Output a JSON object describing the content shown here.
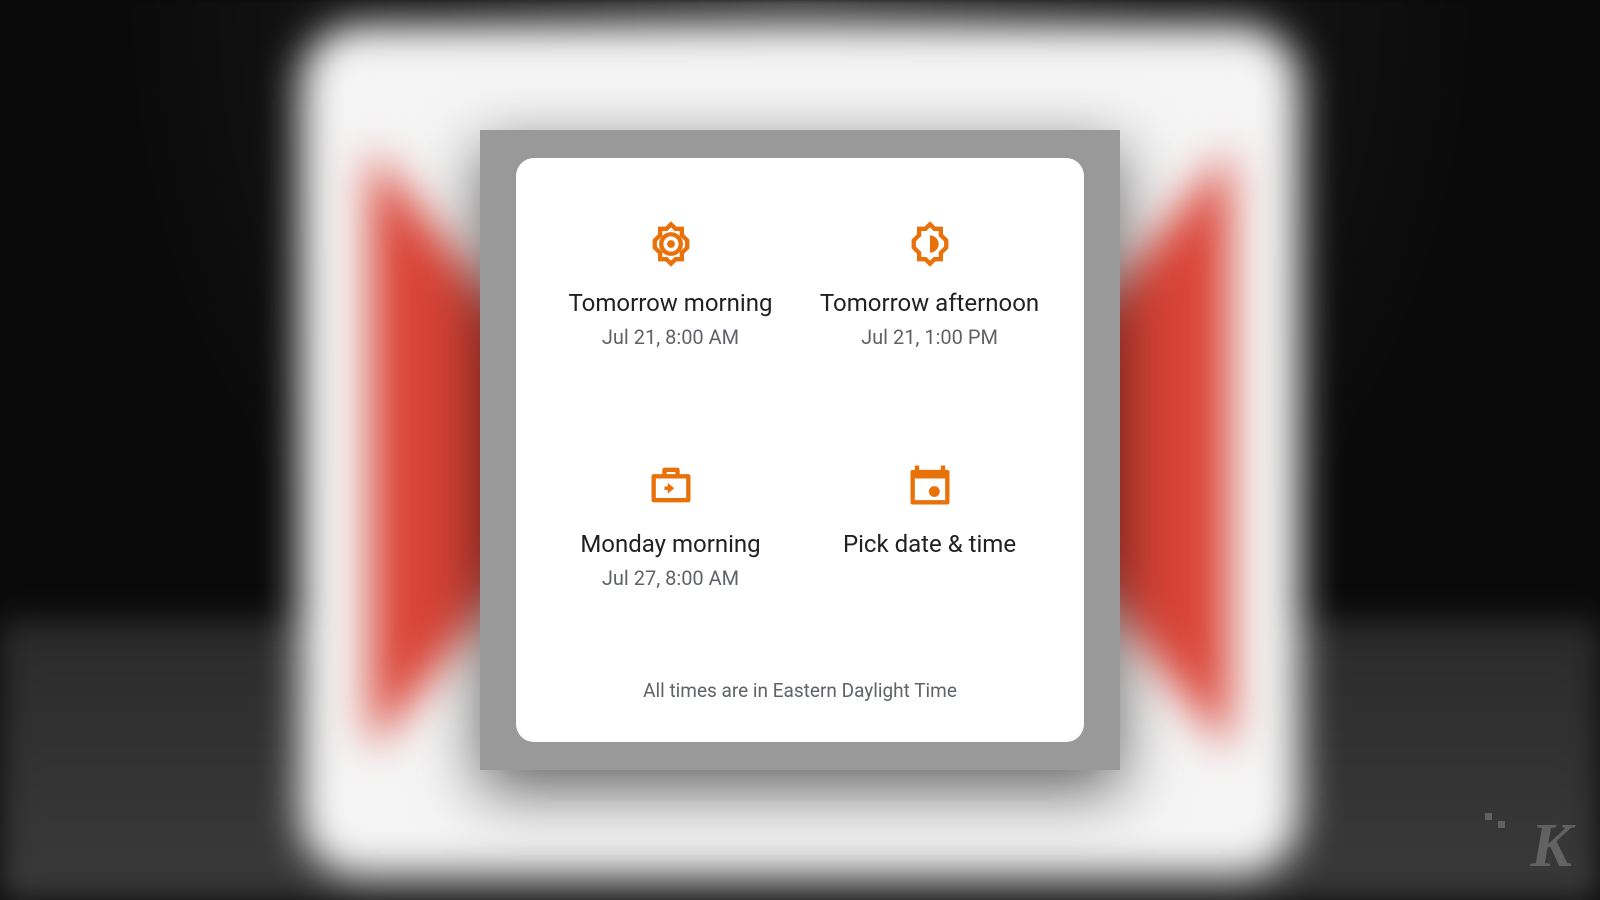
{
  "colors": {
    "accent": "#e8710a"
  },
  "dialog": {
    "options": [
      {
        "id": "tomorrow-morning",
        "title": "Tomorrow morning",
        "subtitle": "Jul 21, 8:00 AM",
        "icon": "brightness-full-icon"
      },
      {
        "id": "tomorrow-afternoon",
        "title": "Tomorrow afternoon",
        "subtitle": "Jul 21, 1:00 PM",
        "icon": "brightness-half-icon"
      },
      {
        "id": "monday-morning",
        "title": "Monday morning",
        "subtitle": "Jul 27, 8:00 AM",
        "icon": "next-week-icon"
      },
      {
        "id": "pick-date-time",
        "title": "Pick date & time",
        "subtitle": "",
        "icon": "calendar-event-icon"
      }
    ],
    "footer": "All times are in Eastern Daylight Time"
  },
  "watermark": "K"
}
